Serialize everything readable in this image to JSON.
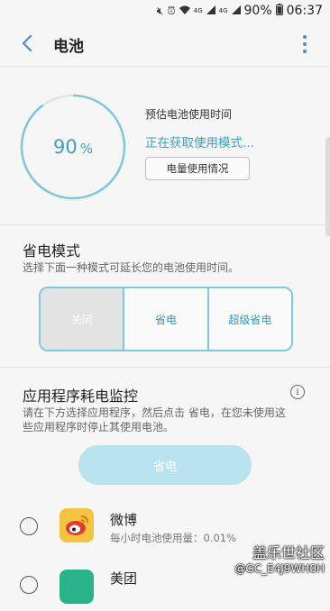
{
  "status_bar": {
    "icons": [
      "mute-icon",
      "alarm-icon",
      "wifi-icon",
      "signal-4g-icon",
      "signal-4g-lte-icon"
    ],
    "lte_top": "4G",
    "lte_bottom": "4G",
    "battery_percent": "90%",
    "time": "06:37"
  },
  "header": {
    "title": "电池"
  },
  "battery": {
    "level": 90,
    "level_text": "90",
    "percent_sign": "%",
    "estimate_label": "预估电池使用时间",
    "estimate_value": "正在获取使用模式...",
    "usage_button": "电量使用情况"
  },
  "power_saving": {
    "title": "省电模式",
    "description": "选择下面一种模式可延长您的电池使用时间。",
    "modes": [
      "关闭",
      "省电",
      "超级省电"
    ],
    "selected_index": 0
  },
  "app_monitor": {
    "title": "应用程序耗电监控",
    "description_line1": "请在下方选择应用程序，然后点击 省电，在您未使用这",
    "description_line2": "些应用程序时停止其使用电池。",
    "save_button": "省电",
    "apps": [
      {
        "name": "微博",
        "usage": "每小时电池使用量：0.01%"
      },
      {
        "name": "美团",
        "usage": ""
      }
    ]
  },
  "watermark": {
    "site": "盖乐世社区",
    "user": "@GC_E4J9WH0H"
  },
  "colors": {
    "accent": "#39a3c3",
    "ring": "#7fc9dc",
    "weibo_bg": "#f5c342",
    "meituan_bg": "#29b38a"
  }
}
